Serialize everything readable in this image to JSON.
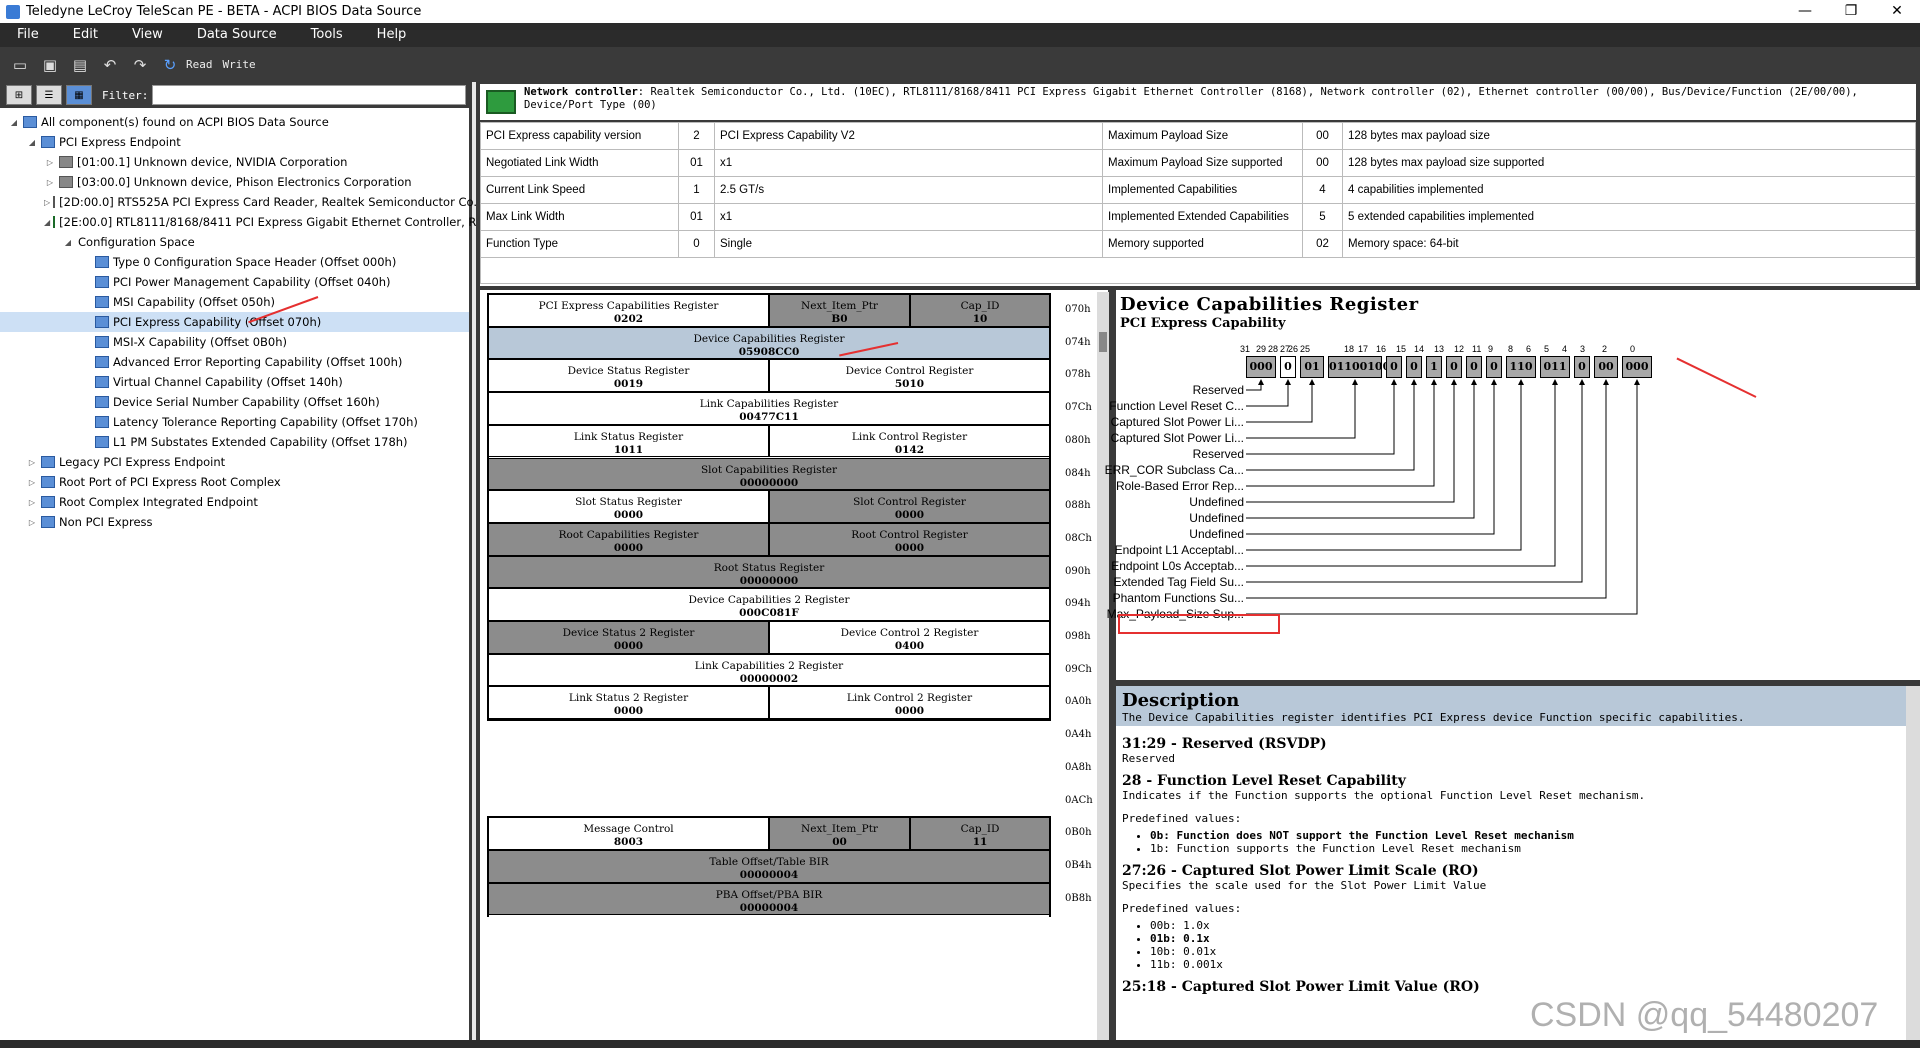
{
  "window": {
    "title": "Teledyne LeCroy TeleScan PE - BETA - ACPI BIOS Data Source",
    "minimize": "—",
    "maximize": "❐",
    "close": "✕"
  },
  "menu": [
    "File",
    "Edit",
    "View",
    "Data Source",
    "Tools",
    "Help"
  ],
  "toolbar": {
    "read_label": "Read",
    "write_label": "Write",
    "icons": [
      "open-icon",
      "save-icon",
      "print-icon",
      "undo-icon",
      "redo-icon",
      "refresh-icon"
    ]
  },
  "left": {
    "filter_label": "Filter:",
    "filter_value": "",
    "view_buttons": [
      "tree-view-icon",
      "list-view-icon",
      "detail-view-icon"
    ]
  },
  "tree": [
    {
      "label": "All component(s) found on ACPI BIOS Data Source",
      "level": 0,
      "expanded": true,
      "icon": "root-icon"
    },
    {
      "label": "PCI Express Endpoint",
      "level": 1,
      "expanded": true,
      "icon": "folder-icon"
    },
    {
      "label": "[01:00.1] Unknown device, NVIDIA Corporation",
      "level": 2,
      "expanded": false,
      "icon": "device-icon"
    },
    {
      "label": "[03:00.0] Unknown device, Phison Electronics Corporation",
      "level": 2,
      "expanded": false,
      "icon": "device-icon"
    },
    {
      "label": "[2D:00.0] RTS525A PCI Express Card Reader, Realtek Semiconductor Co....",
      "level": 2,
      "expanded": false,
      "icon": "device-icon"
    },
    {
      "label": "[2E:00.0] RTL8111/8168/8411 PCI Express Gigabit Ethernet Controller, R...",
      "level": 2,
      "expanded": true,
      "icon": "network-icon"
    },
    {
      "label": "Configuration Space",
      "level": 3,
      "expanded": true,
      "icon": "none"
    },
    {
      "label": "Type 0 Configuration Space Header (Offset 000h)",
      "level": 4,
      "icon": "table-icon"
    },
    {
      "label": "PCI Power Management Capability (Offset 040h)",
      "level": 4,
      "icon": "table-icon"
    },
    {
      "label": "MSI Capability (Offset 050h)",
      "level": 4,
      "icon": "table-icon"
    },
    {
      "label": "PCI Express Capability (Offset 070h)",
      "level": 4,
      "icon": "table-icon",
      "selected": true
    },
    {
      "label": "MSI-X Capability (Offset 0B0h)",
      "level": 4,
      "icon": "table-icon"
    },
    {
      "label": "Advanced Error Reporting Capability (Offset 100h)",
      "level": 4,
      "icon": "table-icon"
    },
    {
      "label": "Virtual Channel Capability (Offset 140h)",
      "level": 4,
      "icon": "table-icon"
    },
    {
      "label": "Device Serial Number Capability (Offset 160h)",
      "level": 4,
      "icon": "table-icon"
    },
    {
      "label": "Latency Tolerance Reporting Capability (Offset 170h)",
      "level": 4,
      "icon": "table-icon"
    },
    {
      "label": "L1 PM Substates Extended Capability (Offset 178h)",
      "level": 4,
      "icon": "table-icon"
    },
    {
      "label": "Legacy PCI Express Endpoint",
      "level": 1,
      "expanded": false,
      "icon": "folder-icon"
    },
    {
      "label": "Root Port of PCI Express Root Complex",
      "level": 1,
      "expanded": false,
      "icon": "folder-icon"
    },
    {
      "label": "Root Complex Integrated Endpoint",
      "level": 1,
      "expanded": false,
      "icon": "folder-icon"
    },
    {
      "label": "Non PCI Express",
      "level": 1,
      "expanded": false,
      "icon": "folder-icon"
    }
  ],
  "device_header": {
    "bold": "Network controller",
    "text": ": Realtek Semiconductor Co., Ltd. (10EC), RTL8111/8168/8411 PCI Express Gigabit Ethernet Controller (8168), Network controller (02), Ethernet controller (00/00), Bus/Device/Function (2E/00/00), Device/Port Type (00)"
  },
  "summary": [
    [
      "PCI Express capability version",
      "2",
      "PCI Express Capability V2",
      "Maximum Payload Size",
      "00",
      "128 bytes max payload size"
    ],
    [
      "Negotiated Link Width",
      "01",
      "x1",
      "Maximum Payload Size supported",
      "00",
      "128 bytes max payload size supported"
    ],
    [
      "Current Link Speed",
      "1",
      "2.5 GT/s",
      "Implemented Capabilities",
      "4",
      "4 capabilities implemented"
    ],
    [
      "Max Link Width",
      "01",
      "x1",
      "Implemented Extended Capabilities",
      "5",
      "5 extended capabilities implemented"
    ],
    [
      "Function Type",
      "0",
      "Single",
      "Memory supported",
      "02",
      "Memory space: 64-bit"
    ]
  ],
  "registers": [
    {
      "name": "PCI Express Capabilities Register",
      "value": "0202",
      "row": 0,
      "col": 0,
      "span": 2,
      "style": "w"
    },
    {
      "name": "Next_Item_Ptr",
      "value": "B0",
      "row": 0,
      "col": 2,
      "span": 1,
      "style": "g"
    },
    {
      "name": "Cap_ID",
      "value": "10",
      "row": 0,
      "col": 3,
      "span": 1,
      "style": "g"
    },
    {
      "name": "Device Capabilities Register",
      "value": "05908CC0",
      "row": 1,
      "col": 0,
      "span": 4,
      "style": "h"
    },
    {
      "name": "Device Status Register",
      "value": "0019",
      "row": 2,
      "col": 0,
      "span": 2,
      "style": "w"
    },
    {
      "name": "Device Control Register",
      "value": "5010",
      "row": 2,
      "col": 2,
      "span": 2,
      "style": "w"
    },
    {
      "name": "Link Capabilities Register",
      "value": "00477C11",
      "row": 3,
      "col": 0,
      "span": 4,
      "style": "w"
    },
    {
      "name": "Link Status Register",
      "value": "1011",
      "row": 4,
      "col": 0,
      "span": 2,
      "style": "w"
    },
    {
      "name": "Link Control Register",
      "value": "0142",
      "row": 4,
      "col": 2,
      "span": 2,
      "style": "w"
    },
    {
      "name": "Slot Capabilities Register",
      "value": "00000000",
      "row": 5,
      "col": 0,
      "span": 4,
      "style": "g"
    },
    {
      "name": "Slot Status Register",
      "value": "0000",
      "row": 6,
      "col": 0,
      "span": 2,
      "style": "w"
    },
    {
      "name": "Slot Control Register",
      "value": "0000",
      "row": 6,
      "col": 2,
      "span": 2,
      "style": "g"
    },
    {
      "name": "Root Capabilities Register",
      "value": "0000",
      "row": 7,
      "col": 0,
      "span": 2,
      "style": "g"
    },
    {
      "name": "Root Control Register",
      "value": "0000",
      "row": 7,
      "col": 2,
      "span": 2,
      "style": "g"
    },
    {
      "name": "Root Status Register",
      "value": "00000000",
      "row": 8,
      "col": 0,
      "span": 4,
      "style": "g"
    },
    {
      "name": "Device Capabilities 2 Register",
      "value": "000C081F",
      "row": 9,
      "col": 0,
      "span": 4,
      "style": "w"
    },
    {
      "name": "Device Status 2 Register",
      "value": "0000",
      "row": 10,
      "col": 0,
      "span": 2,
      "style": "g"
    },
    {
      "name": "Device Control 2 Register",
      "value": "0400",
      "row": 10,
      "col": 2,
      "span": 2,
      "style": "w"
    },
    {
      "name": "Link Capabilities 2 Register",
      "value": "00000002",
      "row": 11,
      "col": 0,
      "span": 4,
      "style": "w"
    },
    {
      "name": "Link Status 2 Register",
      "value": "0000",
      "row": 12,
      "col": 0,
      "span": 2,
      "style": "w"
    },
    {
      "name": "Link Control 2 Register",
      "value": "0000",
      "row": 12,
      "col": 2,
      "span": 2,
      "style": "w"
    },
    {
      "name": "Message Control",
      "value": "8003",
      "row": 16,
      "col": 0,
      "span": 2,
      "style": "w"
    },
    {
      "name": "Next_Item_Ptr",
      "value": "00",
      "row": 16,
      "col": 2,
      "span": 1,
      "style": "g"
    },
    {
      "name": "Cap_ID",
      "value": "11",
      "row": 16,
      "col": 3,
      "span": 1,
      "style": "g"
    },
    {
      "name": "Table Offset/Table BIR",
      "value": "00000004",
      "row": 17,
      "col": 0,
      "span": 4,
      "style": "g"
    },
    {
      "name": "PBA Offset/PBA BIR",
      "value": "00000004",
      "row": 18,
      "col": 0,
      "span": 4,
      "style": "g"
    }
  ],
  "offsets": [
    "070h",
    "074h",
    "078h",
    "07Ch",
    "080h",
    "084h",
    "088h",
    "08Ch",
    "090h",
    "094h",
    "098h",
    "09Ch",
    "0A0h",
    "0A4h",
    "0A8h",
    "0ACh",
    "0B0h",
    "0B4h",
    "0B8h"
  ],
  "bit_panel": {
    "title": "Device Capabilities Register",
    "subtitle": "PCI Express Capability",
    "bit_numbers": [
      "31",
      "29",
      "28",
      "27",
      "26",
      "25",
      "18",
      "17",
      "16",
      "15",
      "14",
      "13",
      "12",
      "11",
      "9",
      "8",
      "6",
      "5",
      "4",
      "3",
      "2",
      "0"
    ],
    "fields": [
      {
        "value": "000",
        "label": "Reserved"
      },
      {
        "value": "0",
        "label": "Function Level Reset C...",
        "white": true
      },
      {
        "value": "01",
        "label": "Captured Slot Power Li..."
      },
      {
        "value": "01100100",
        "label": "Captured Slot Power Li..."
      },
      {
        "value": "0",
        "label": "Reserved"
      },
      {
        "value": "0",
        "label": "ERR_COR Subclass Ca..."
      },
      {
        "value": "1",
        "label": "Role-Based Error Rep..."
      },
      {
        "value": "0",
        "label": "Undefined"
      },
      {
        "value": "0",
        "label": "Undefined"
      },
      {
        "value": "0",
        "label": "Undefined"
      },
      {
        "value": "110",
        "label": "Endpoint L1 Acceptabl..."
      },
      {
        "value": "011",
        "label": "Endpoint L0s Acceptab..."
      },
      {
        "value": "0",
        "label": "Extended Tag Field Su..."
      },
      {
        "value": "00",
        "label": "Phantom Functions Su..."
      },
      {
        "value": "000",
        "label": "Max_Payload_Size Sup..."
      }
    ]
  },
  "description": {
    "title": "Description",
    "summary": "The Device Capabilities register identifies PCI Express device Function specific capabilities.",
    "sections": [
      {
        "heading": "31:29 - Reserved (RSVDP)",
        "text": "Reserved"
      },
      {
        "heading": "28 - Function Level Reset Capability",
        "text": "Indicates if the Function supports the optional Function Level Reset mechanism.",
        "predef": "Predefined values:",
        "values": [
          "0b: Function does NOT support the Function Level Reset mechanism",
          "1b: Function supports the Function Level Reset mechanism"
        ],
        "bold_index": 0
      },
      {
        "heading": "27:26 - Captured Slot Power Limit Scale (RO)",
        "text": "Specifies the scale used for the Slot Power Limit Value",
        "predef": "Predefined values:",
        "values": [
          "00b: 1.0x",
          "01b: 0.1x",
          "10b: 0.01x",
          "11b: 0.001x"
        ],
        "bold_index": 1
      },
      {
        "heading": "25:18 - Captured Slot Power Limit Value (RO)",
        "text": ""
      }
    ]
  },
  "watermark": "CSDN @qq_54480207",
  "colors": {
    "menubar": "#2b2b2b",
    "selected": "#cde0f5",
    "highlight": "#b8c8d8",
    "annotation": "#e53030"
  }
}
